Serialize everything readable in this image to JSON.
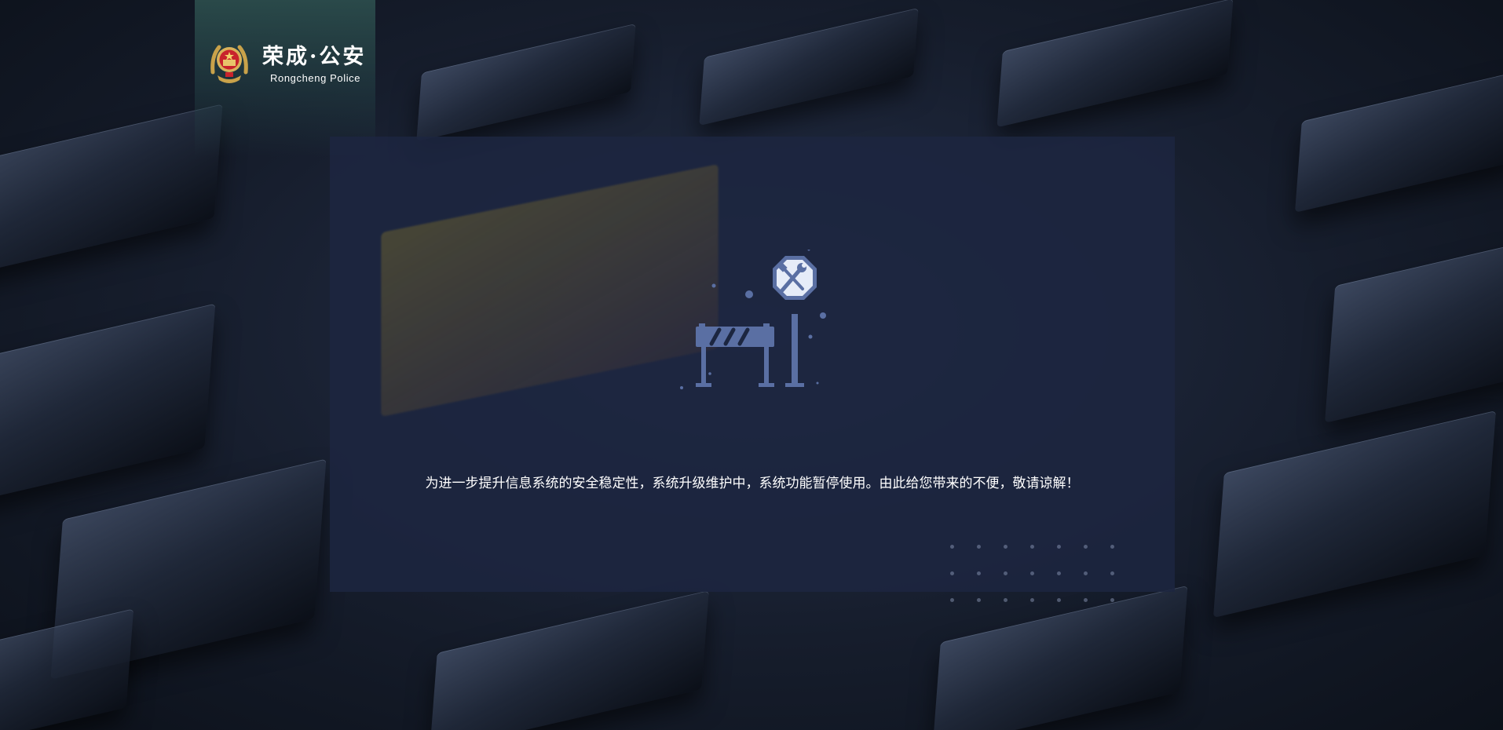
{
  "logo": {
    "name_cn": "荣成·公安",
    "name_en": "Rongcheng Police"
  },
  "maintenance": {
    "message": "为进一步提升信息系统的安全稳定性，系统升级维护中，系统功能暂停使用。由此给您带来的不便，敬请谅解！",
    "illustration_icon": "maintenance-tools-sign-icon"
  },
  "colors": {
    "background": "#141a26",
    "card": "#1c2640",
    "accent": "#5a6fa3",
    "logo_panel": "#2e5250",
    "text": "#ffffff"
  }
}
